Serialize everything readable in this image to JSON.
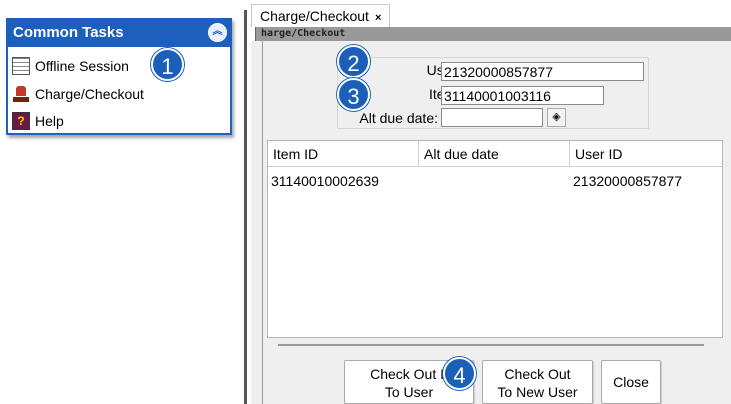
{
  "tasks_panel": {
    "title": "Common Tasks",
    "collapse_glyph": "»",
    "items": [
      {
        "label": "Offline Session",
        "icon": "offline-session-icon"
      },
      {
        "label": "Charge/Checkout",
        "icon": "charge-checkout-icon"
      },
      {
        "label": "Help",
        "icon": "help-icon"
      }
    ]
  },
  "callouts": [
    "1",
    "2",
    "3",
    "4"
  ],
  "tab": {
    "label": "Charge/Checkout",
    "close_glyph": "×"
  },
  "title_strip": "harge/Checkout",
  "form": {
    "user_id_label": "User ID:",
    "user_id_value": "21320000857877",
    "item_id_label": "Item ID:",
    "item_id_value": "31140001003116",
    "alt_due_label": "Alt due date:",
    "alt_due_value": "",
    "calendar_glyph": "◈"
  },
  "table": {
    "columns": [
      "Item ID",
      "Alt due date",
      "User ID"
    ],
    "rows": [
      [
        "31140010002639",
        "",
        "21320000857877"
      ]
    ]
  },
  "buttons": {
    "check_out_item": "Check Out Item To User",
    "check_out_item_line1": "Check Out It",
    "check_out_item_line2": "To User",
    "check_out_new_line1": "Check Out",
    "check_out_new_line2": "To New User",
    "close": "Close"
  },
  "colors": {
    "panel_header": "#1d5fbf",
    "callout": "#1b5fb8"
  }
}
